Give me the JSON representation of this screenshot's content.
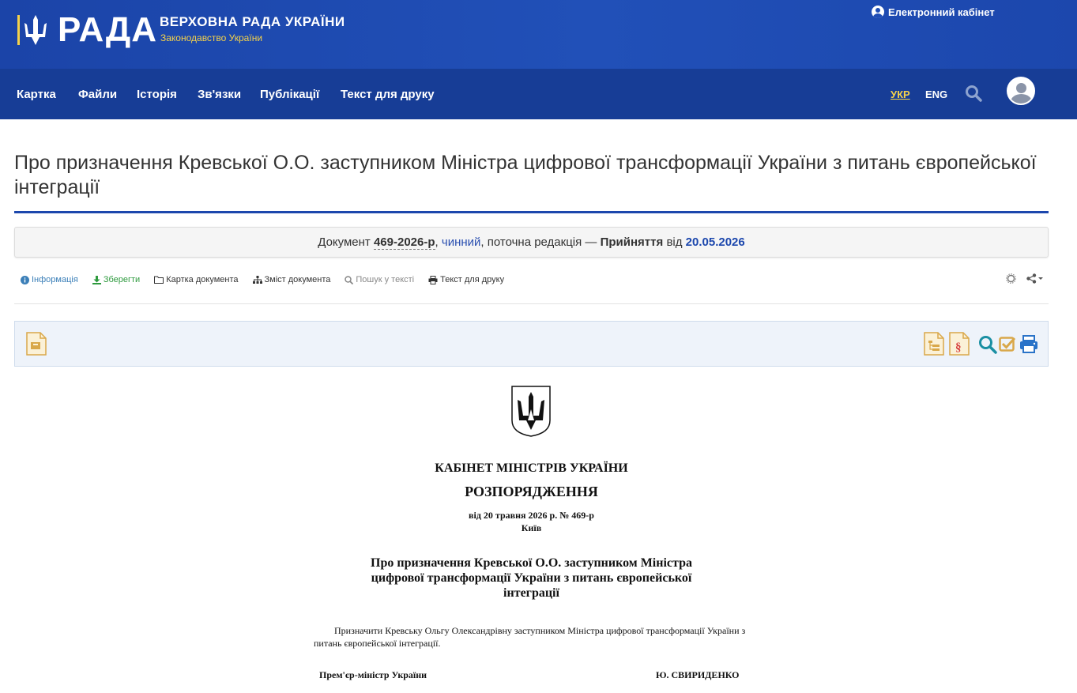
{
  "header": {
    "logo_text": "РАДА",
    "site_title": "ВЕРХОВНА РАДА УКРАЇНИ",
    "site_subtitle": "Законодавство України",
    "cabinet_label": "Електронний кабінет"
  },
  "nav": {
    "items": [
      "Картка",
      "Файли",
      "Історія",
      "Зв'язки",
      "Публікації",
      "Текст для друку"
    ],
    "lang_ukr": "УКР",
    "lang_eng": "ENG"
  },
  "page": {
    "title": "Про призначення Кревської О.О. заступником Міністра цифрової трансформації України з питань європейської інтеграції"
  },
  "status": {
    "prefix": "Документ",
    "number": "469-2026-р",
    "state": "чинний",
    "edition": ", поточна редакція —",
    "event": "Прийняття",
    "from": "від",
    "date": "20.05.2026"
  },
  "toolbar": {
    "info": "Інформація",
    "save": "Зберегти",
    "card": "Картка документа",
    "contents": "Зміст документа",
    "search": "Пошук у тексті",
    "print": "Текст для друку"
  },
  "document": {
    "org": "КАБІНЕТ МІНІСТРІВ УКРАЇНИ",
    "type": "РОЗПОРЯДЖЕННЯ",
    "date_line": "від 20 травня 2026 р. № 469-р",
    "city": "Київ",
    "heading": "Про призначення Кревської О.О. заступником Міністра цифрової трансформації України з питань європейської інтеграції",
    "body": "Призначити Кревську Ольгу Олександрівну заступником Міністра цифрової трансформації України з питань європейської інтеграції.",
    "sign_position": "Прем'єр-міністр України",
    "sign_name": "Ю. СВИРИДЕНКО"
  },
  "colors": {
    "header_blue": "#1f4db5",
    "nav_blue": "#173d96",
    "accent_yellow": "#f5d24a",
    "link_blue": "#1c47ad"
  }
}
